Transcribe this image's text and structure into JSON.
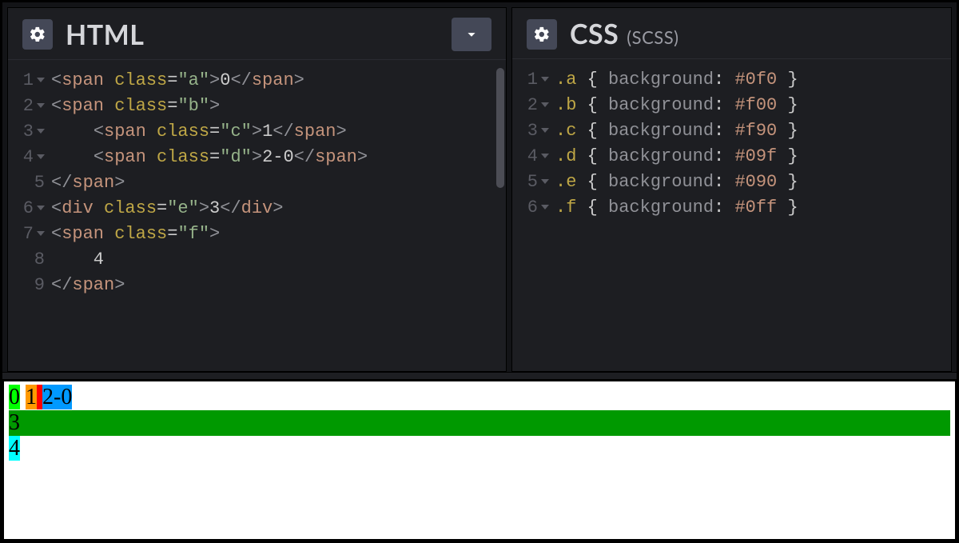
{
  "panels": {
    "html": {
      "title": "HTML",
      "lines": [
        {
          "n": "1",
          "fold": true,
          "tokens": [
            [
              "angle",
              "<"
            ],
            [
              "tag",
              "span"
            ],
            [
              "txt",
              " "
            ],
            [
              "attr",
              "class"
            ],
            [
              "eq",
              "="
            ],
            [
              "str",
              "\"a\""
            ],
            [
              "angle",
              ">"
            ],
            [
              "txt",
              "0"
            ],
            [
              "angle",
              "</"
            ],
            [
              "tag",
              "span"
            ],
            [
              "angle",
              ">"
            ]
          ]
        },
        {
          "n": "2",
          "fold": true,
          "tokens": [
            [
              "angle",
              "<"
            ],
            [
              "tag",
              "span"
            ],
            [
              "txt",
              " "
            ],
            [
              "attr",
              "class"
            ],
            [
              "eq",
              "="
            ],
            [
              "str",
              "\"b\""
            ],
            [
              "angle",
              ">"
            ]
          ]
        },
        {
          "n": "3",
          "fold": true,
          "tokens": [
            [
              "txt",
              "    "
            ],
            [
              "angle",
              "<"
            ],
            [
              "tag",
              "span"
            ],
            [
              "txt",
              " "
            ],
            [
              "attr",
              "class"
            ],
            [
              "eq",
              "="
            ],
            [
              "str",
              "\"c\""
            ],
            [
              "angle",
              ">"
            ],
            [
              "txt",
              "1"
            ],
            [
              "angle",
              "</"
            ],
            [
              "tag",
              "span"
            ],
            [
              "angle",
              ">"
            ]
          ]
        },
        {
          "n": "4",
          "fold": true,
          "tokens": [
            [
              "txt",
              "    "
            ],
            [
              "angle",
              "<"
            ],
            [
              "tag",
              "span"
            ],
            [
              "txt",
              " "
            ],
            [
              "attr",
              "class"
            ],
            [
              "eq",
              "="
            ],
            [
              "str",
              "\"d\""
            ],
            [
              "angle",
              ">"
            ],
            [
              "txt",
              "2-0"
            ],
            [
              "angle",
              "</"
            ],
            [
              "tag",
              "span"
            ],
            [
              "angle",
              ">"
            ]
          ]
        },
        {
          "n": "5",
          "fold": false,
          "tokens": [
            [
              "angle",
              "</"
            ],
            [
              "tag",
              "span"
            ],
            [
              "angle",
              ">"
            ]
          ]
        },
        {
          "n": "6",
          "fold": true,
          "tokens": [
            [
              "angle",
              "<"
            ],
            [
              "tag",
              "div"
            ],
            [
              "txt",
              " "
            ],
            [
              "attr",
              "class"
            ],
            [
              "eq",
              "="
            ],
            [
              "str",
              "\"e\""
            ],
            [
              "angle",
              ">"
            ],
            [
              "txt",
              "3"
            ],
            [
              "angle",
              "</"
            ],
            [
              "tag",
              "div"
            ],
            [
              "angle",
              ">"
            ]
          ]
        },
        {
          "n": "7",
          "fold": true,
          "tokens": [
            [
              "angle",
              "<"
            ],
            [
              "tag",
              "span"
            ],
            [
              "txt",
              " "
            ],
            [
              "attr",
              "class"
            ],
            [
              "eq",
              "="
            ],
            [
              "str",
              "\"f\""
            ],
            [
              "angle",
              ">"
            ]
          ]
        },
        {
          "n": "8",
          "fold": false,
          "tokens": [
            [
              "txt",
              "    4"
            ]
          ]
        },
        {
          "n": "9",
          "fold": false,
          "tokens": [
            [
              "angle",
              "</"
            ],
            [
              "tag",
              "span"
            ],
            [
              "angle",
              ">"
            ]
          ]
        }
      ]
    },
    "css": {
      "title": "CSS",
      "subtitle": "(SCSS)",
      "lines": [
        {
          "n": "1",
          "fold": true,
          "tokens": [
            [
              "sel",
              ".a"
            ],
            [
              "txt",
              " "
            ],
            [
              "brace",
              "{"
            ],
            [
              "txt",
              " "
            ],
            [
              "prop",
              "background"
            ],
            [
              "colon",
              ":"
            ],
            [
              "txt",
              " "
            ],
            [
              "hex",
              "#0f0"
            ],
            [
              "txt",
              " "
            ],
            [
              "brace",
              "}"
            ]
          ]
        },
        {
          "n": "2",
          "fold": true,
          "tokens": [
            [
              "sel",
              ".b"
            ],
            [
              "txt",
              " "
            ],
            [
              "brace",
              "{"
            ],
            [
              "txt",
              " "
            ],
            [
              "prop",
              "background"
            ],
            [
              "colon",
              ":"
            ],
            [
              "txt",
              " "
            ],
            [
              "hex",
              "#f00"
            ],
            [
              "txt",
              " "
            ],
            [
              "brace",
              "}"
            ]
          ]
        },
        {
          "n": "3",
          "fold": true,
          "tokens": [
            [
              "sel",
              ".c"
            ],
            [
              "txt",
              " "
            ],
            [
              "brace",
              "{"
            ],
            [
              "txt",
              " "
            ],
            [
              "prop",
              "background"
            ],
            [
              "colon",
              ":"
            ],
            [
              "txt",
              " "
            ],
            [
              "hex",
              "#f90"
            ],
            [
              "txt",
              " "
            ],
            [
              "brace",
              "}"
            ]
          ]
        },
        {
          "n": "4",
          "fold": true,
          "tokens": [
            [
              "sel",
              ".d"
            ],
            [
              "txt",
              " "
            ],
            [
              "brace",
              "{"
            ],
            [
              "txt",
              " "
            ],
            [
              "prop",
              "background"
            ],
            [
              "colon",
              ":"
            ],
            [
              "txt",
              " "
            ],
            [
              "hex",
              "#09f"
            ],
            [
              "txt",
              " "
            ],
            [
              "brace",
              "}"
            ]
          ]
        },
        {
          "n": "5",
          "fold": true,
          "tokens": [
            [
              "sel",
              ".e"
            ],
            [
              "txt",
              " "
            ],
            [
              "brace",
              "{"
            ],
            [
              "txt",
              " "
            ],
            [
              "prop",
              "background"
            ],
            [
              "colon",
              ":"
            ],
            [
              "txt",
              " "
            ],
            [
              "hex",
              "#090"
            ],
            [
              "txt",
              " "
            ],
            [
              "brace",
              "}"
            ]
          ]
        },
        {
          "n": "6",
          "fold": true,
          "tokens": [
            [
              "sel",
              ".f"
            ],
            [
              "txt",
              " "
            ],
            [
              "brace",
              "{"
            ],
            [
              "txt",
              " "
            ],
            [
              "prop",
              "background"
            ],
            [
              "colon",
              ":"
            ],
            [
              "txt",
              " "
            ],
            [
              "hex",
              "#0ff"
            ],
            [
              "txt",
              " "
            ],
            [
              "brace",
              "}"
            ]
          ]
        }
      ]
    }
  },
  "output": {
    "a": "0",
    "c": "1",
    "d": "2-0",
    "e": "3",
    "f": "4"
  }
}
